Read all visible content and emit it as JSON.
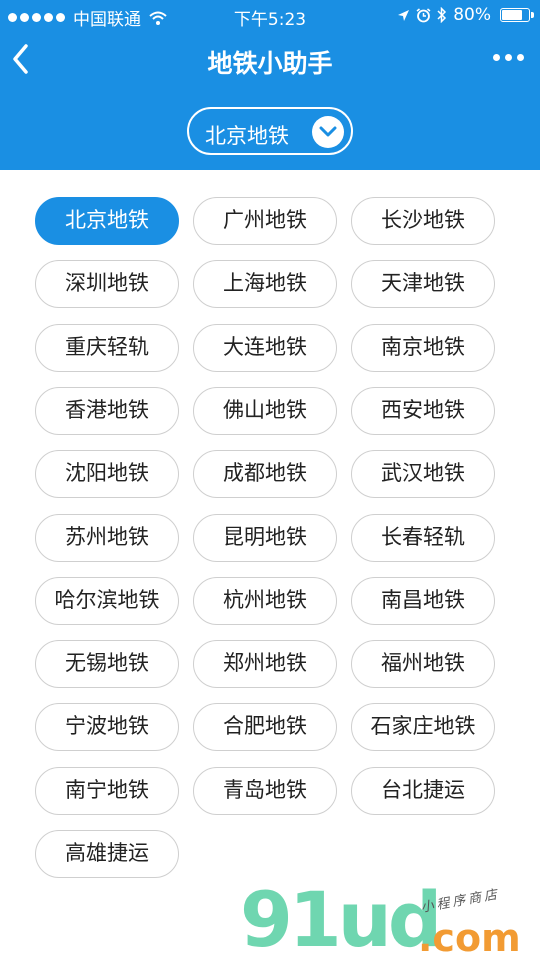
{
  "status_bar": {
    "carrier": "中国联通",
    "time": "下午5:23",
    "battery_percent": "80%",
    "battery_level": 0.8
  },
  "nav": {
    "title": "地铁小助手"
  },
  "selector": {
    "current_city": "北京地铁"
  },
  "cities": [
    "北京地铁",
    "广州地铁",
    "长沙地铁",
    "深圳地铁",
    "上海地铁",
    "天津地铁",
    "重庆轻轨",
    "大连地铁",
    "南京地铁",
    "香港地铁",
    "佛山地铁",
    "西安地铁",
    "沈阳地铁",
    "成都地铁",
    "武汉地铁",
    "苏州地铁",
    "昆明地铁",
    "长春轻轨",
    "哈尔滨地铁",
    "杭州地铁",
    "南昌地铁",
    "无锡地铁",
    "郑州地铁",
    "福州地铁",
    "宁波地铁",
    "合肥地铁",
    "石家庄地铁",
    "南宁地铁",
    "青岛地铁",
    "台北捷运",
    "高雄捷运"
  ],
  "selected_city_index": 0,
  "watermark": {
    "brand": "91ud",
    "domain": ".com",
    "tagline": "小程序商店"
  },
  "colors": {
    "primary": "#1a8fe3",
    "button_border": "#cfcfcf"
  }
}
